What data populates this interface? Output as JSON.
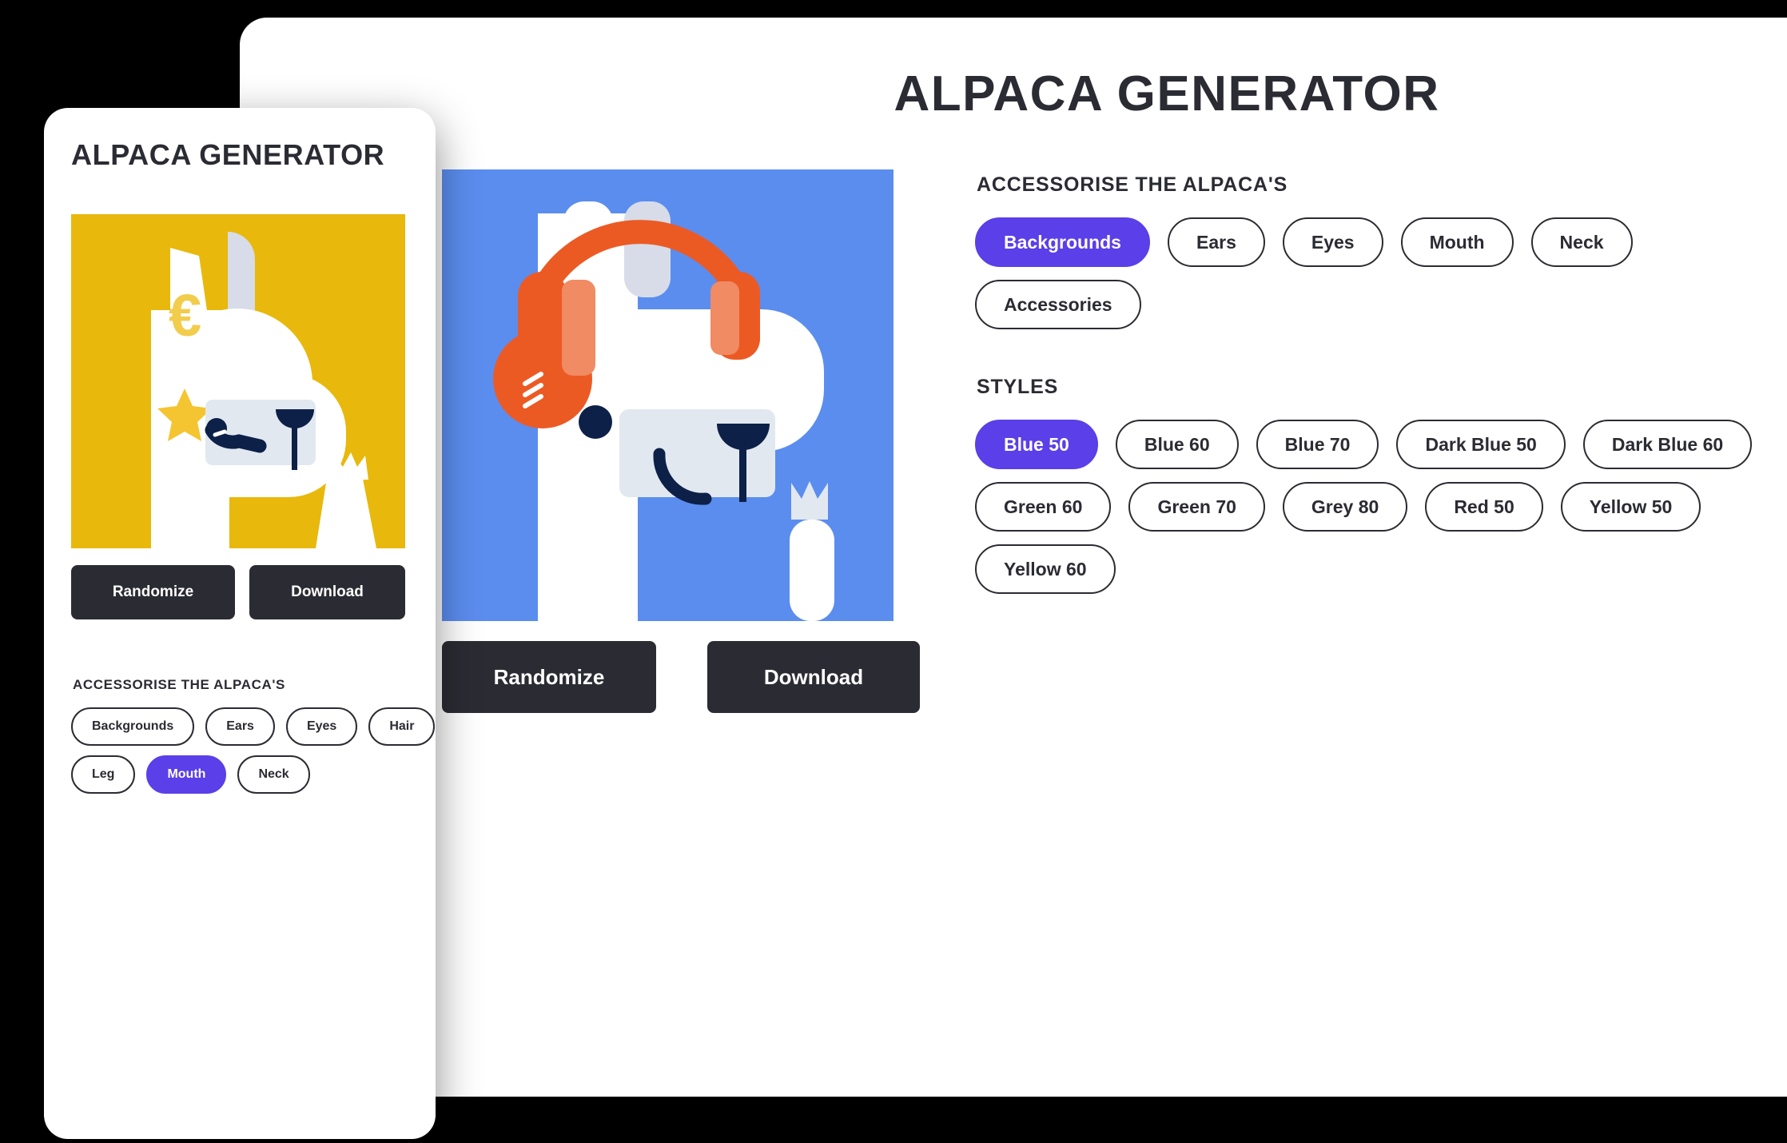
{
  "app": {
    "title": "ALPACA GENERATOR"
  },
  "desktop": {
    "title": "ALPACA GENERATOR",
    "randomize_label": "Randomize",
    "download_label": "Download",
    "accessorise_heading": "ACCESSORISE THE ALPACA'S",
    "accessorise_chips": [
      {
        "label": "Backgrounds",
        "selected": true
      },
      {
        "label": "Ears",
        "selected": false
      },
      {
        "label": "Eyes",
        "selected": false
      },
      {
        "label": "Mouth",
        "selected": false
      },
      {
        "label": "Neck",
        "selected": false
      },
      {
        "label": "Accessories",
        "selected": false
      }
    ],
    "styles_heading": "STYLES",
    "style_chips": [
      {
        "label": "Blue 50",
        "selected": true
      },
      {
        "label": "Blue 60",
        "selected": false
      },
      {
        "label": "Blue 70",
        "selected": false
      },
      {
        "label": "Dark Blue 50",
        "selected": false
      },
      {
        "label": "Dark Blue 60",
        "selected": false
      },
      {
        "label": "Green 60",
        "selected": false
      },
      {
        "label": "Green 70",
        "selected": false
      },
      {
        "label": "Grey 80",
        "selected": false
      },
      {
        "label": "Red 50",
        "selected": false
      },
      {
        "label": "Yellow 50",
        "selected": false
      },
      {
        "label": "Yellow 60",
        "selected": false
      }
    ],
    "canvas": {
      "background_color": "#5B8DEF",
      "accessory": "headphones",
      "accessory_color": "#EC5A24",
      "accessory_accent_color": "#F08B63",
      "body_color": "#FFFFFF",
      "snout_color": "#E2E8F0",
      "eye_color": "#0D2048",
      "mouth_color": "#0D2048"
    }
  },
  "mobile": {
    "title": "ALPACA GENERATOR",
    "randomize_label": "Randomize",
    "download_label": "Download",
    "accessorise_heading": "ACCESSORISE THE ALPACA'S",
    "accessorise_chips": [
      {
        "label": "Backgrounds",
        "selected": false
      },
      {
        "label": "Ears",
        "selected": false
      },
      {
        "label": "Eyes",
        "selected": false
      },
      {
        "label": "Hair",
        "selected": false
      },
      {
        "label": "Leg",
        "selected": false
      },
      {
        "label": "Mouth",
        "selected": true
      },
      {
        "label": "Neck",
        "selected": false
      }
    ],
    "canvas": {
      "background_color": "#E8B80C",
      "accessory": "euro-sign",
      "accessory_color": "#F2CC4B",
      "star_color": "#F5C431",
      "body_color": "#FFFFFF",
      "snout_color": "#E2E8F0",
      "ear_color": "#D7DCE8",
      "eye_color": "#0D2048",
      "mouth_color": "#0D2048"
    }
  },
  "theme": {
    "accent": "#5B3FE8",
    "dark": "#2B2B33",
    "page_background": "#000000",
    "card_background": "#FFFFFF"
  }
}
